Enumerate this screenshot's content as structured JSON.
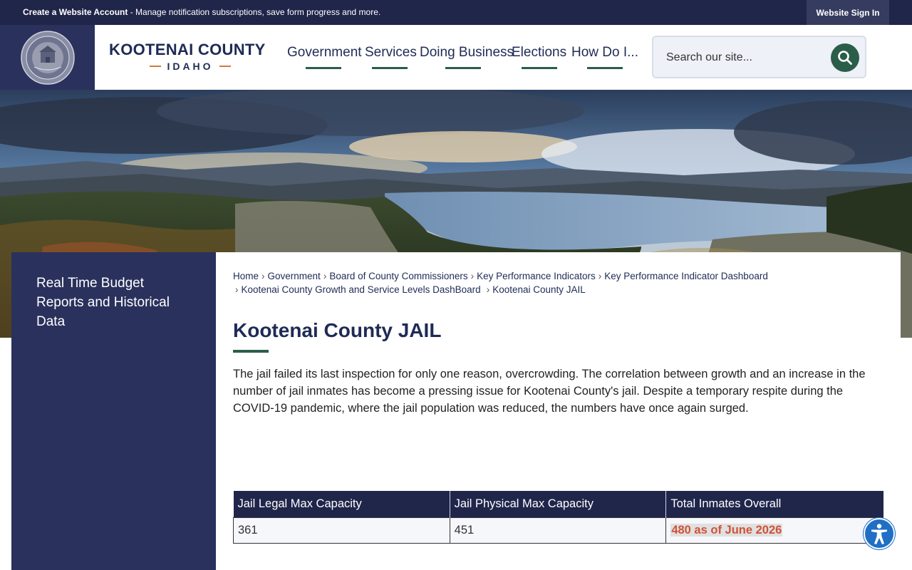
{
  "topbar": {
    "create_account": "Create a Website Account",
    "create_desc": " - Manage notification subscriptions, save form progress and more.",
    "sign_in": "Website Sign In"
  },
  "header": {
    "logo_county": "KOOTENAI COUNTY",
    "logo_state": "IDAHO",
    "nav": [
      "Government",
      "Services",
      "Doing Business",
      "Elections",
      "How Do I..."
    ],
    "search_placeholder": "Search our site..."
  },
  "sidebar": {
    "link": "Real Time Budget Reports and Historical Data"
  },
  "breadcrumb": [
    "Home",
    "Government",
    "Board of County Commissioners",
    "Key Performance Indicators",
    "Key Performance Indicator Dashboard",
    "Kootenai County Growth and Service Levels DashBoard",
    "Kootenai County JAIL"
  ],
  "page": {
    "title": "Kootenai County JAIL",
    "intro": "The jail failed its last inspection for only one reason, overcrowding. The correlation between growth and an increase in the number of jail inmates has become a pressing issue for Kootenai County's jail. Despite a temporary respite during the COVID-19 pandemic, where the jail population was reduced, the numbers have once again surged."
  },
  "table": {
    "headers": [
      "Jail Legal Max Capacity",
      "Jail Physical Max Capacity",
      "Total Inmates Overall"
    ],
    "row": [
      "361",
      "451",
      "480 as of June 2026"
    ]
  },
  "colors": {
    "navy": "#20254a",
    "sidebar": "#2a315c",
    "accent_green": "#2b5e4a",
    "highlight_red": "#d05237"
  },
  "icons": {
    "search": "search-icon",
    "accessibility": "accessibility-icon",
    "seal": "county-seal-icon"
  }
}
